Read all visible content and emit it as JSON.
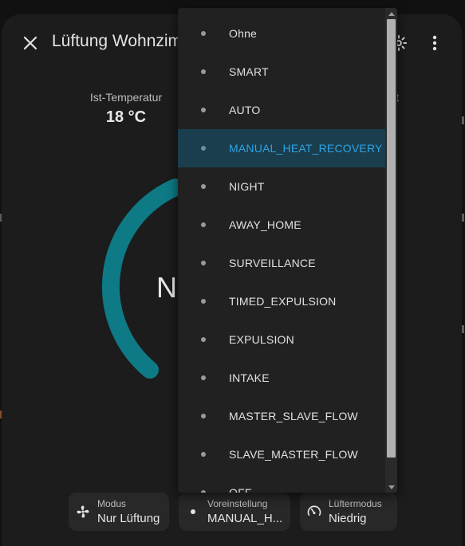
{
  "dialog": {
    "title": "Lüftung Wohnzimmer",
    "current_temp": {
      "label": "Ist-Temperatur",
      "value": "18 °C"
    },
    "target_label_tail": "t",
    "gauge_text": "N"
  },
  "chips": {
    "mode": {
      "label": "Modus",
      "value": "Nur Lüftung"
    },
    "preset": {
      "label": "Voreinstellung",
      "value": "MANUAL_H..."
    },
    "fan": {
      "label": "Lüftermodus",
      "value": "Niedrig"
    }
  },
  "menu": {
    "selected": "MANUAL_HEAT_RECOVERY",
    "items": [
      "Ohne",
      "SMART",
      "AUTO",
      "MANUAL_HEAT_RECOVERY",
      "NIGHT",
      "AWAY_HOME",
      "SURVEILLANCE",
      "TIMED_EXPULSION",
      "EXPULSION",
      "INTAKE",
      "MASTER_SLAVE_FLOW",
      "SLAVE_MASTER_FLOW",
      "OFF"
    ]
  },
  "icons": {
    "close": "close-icon",
    "settings": "gear-icon",
    "more": "more-vertical-icon",
    "fan": "fan-icon",
    "preset": "dot-icon",
    "fan_mode": "speedometer-icon"
  },
  "colors": {
    "accent": "#2ea3e6",
    "gauge": "#0e7a85",
    "selected_bg": "#1a3e4d"
  }
}
